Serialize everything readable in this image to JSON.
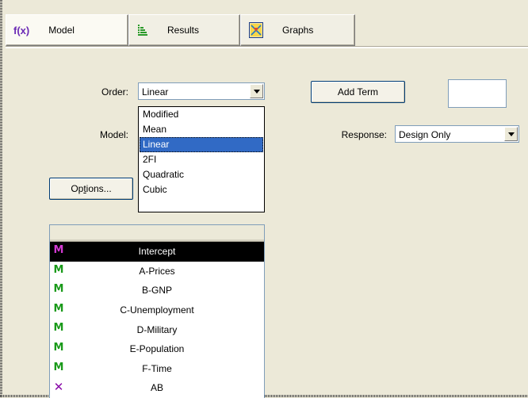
{
  "tabs": [
    {
      "label": "Model",
      "icon": "fx-icon",
      "icon_text": "f(x)",
      "active": true
    },
    {
      "label": "Results",
      "icon": "results-table-icon",
      "active": false
    },
    {
      "label": "Graphs",
      "icon": "graphs-icon",
      "active": false
    }
  ],
  "order": {
    "label": "Order:",
    "value": "Linear"
  },
  "order_options": [
    "Modified",
    "Mean",
    "Linear",
    "2FI",
    "Quadratic",
    "Cubic"
  ],
  "order_selected": "Linear",
  "model": {
    "label": "Model:"
  },
  "add_term": {
    "label": "Add Term"
  },
  "term_input": {
    "value": ""
  },
  "response": {
    "label": "Response:",
    "value": "Design Only"
  },
  "options_button": {
    "label": "Options...",
    "mnemonic_prefix": "Op",
    "mnemonic_char": "t",
    "mnemonic_suffix": "ions..."
  },
  "terms": [
    {
      "name": "Intercept",
      "type": "M",
      "selected": true
    },
    {
      "name": "A-Prices",
      "type": "M",
      "selected": false
    },
    {
      "name": "B-GNP",
      "type": "M",
      "selected": false
    },
    {
      "name": "C-Unemployment",
      "type": "M",
      "selected": false
    },
    {
      "name": "D-Military",
      "type": "M",
      "selected": false
    },
    {
      "name": "E-Population",
      "type": "M",
      "selected": false
    },
    {
      "name": "F-Time",
      "type": "M",
      "selected": false
    },
    {
      "name": "AB",
      "type": "X",
      "selected": false
    }
  ],
  "colors": {
    "model_term": "#1a9a1a",
    "intercept_term": "#d23ad2",
    "excluded_term": "#8a0aa8",
    "selection": "#316ac5",
    "fx_icon": "#6b2ab5"
  }
}
